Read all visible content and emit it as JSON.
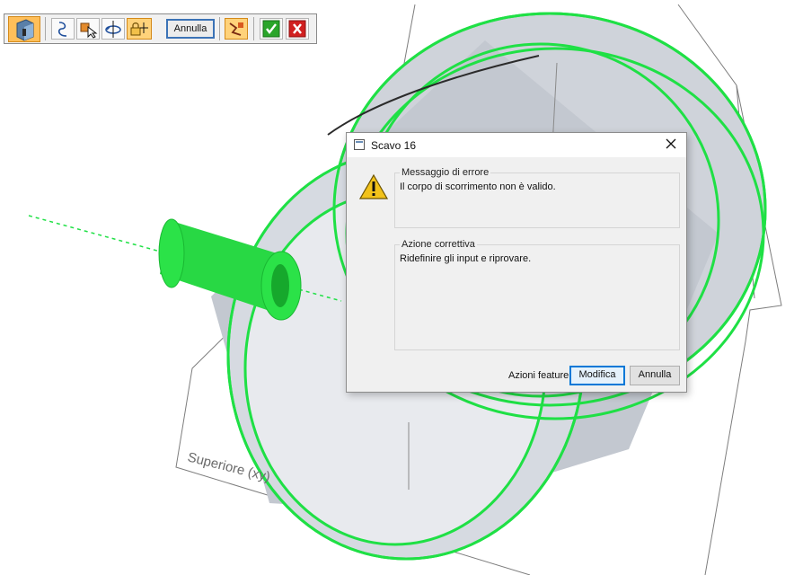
{
  "viewport": {
    "plane_label": "Superiore (xy)",
    "colors": {
      "highlight": "#1fe045",
      "body": "#c9ced6",
      "axis": "#1fe045"
    }
  },
  "toolbar": {
    "buttons": [
      {
        "name": "feature-type-icon"
      },
      {
        "name": "profile-step-icon"
      },
      {
        "name": "select-face-icon"
      },
      {
        "name": "revolve-axis-icon"
      },
      {
        "name": "lock-extent-icon"
      },
      {
        "name": "treatment-icon"
      },
      {
        "name": "finish-check-icon"
      },
      {
        "name": "cancel-x-icon"
      }
    ],
    "cancel_label": "Annulla",
    "colors": {
      "check": "#2aa52a",
      "cancel": "#d12020"
    }
  },
  "dialog": {
    "title": "Scavo 16",
    "error_caption": "Messaggio di errore",
    "error_text": "Il corpo di scorrimento non è valido.",
    "fix_caption": "Azione correttiva",
    "fix_text": "Ridefinire gli input e riprovare.",
    "actions_label": "Azioni feature:",
    "modify_label": "Modifica",
    "cancel_label": "Annulla"
  }
}
